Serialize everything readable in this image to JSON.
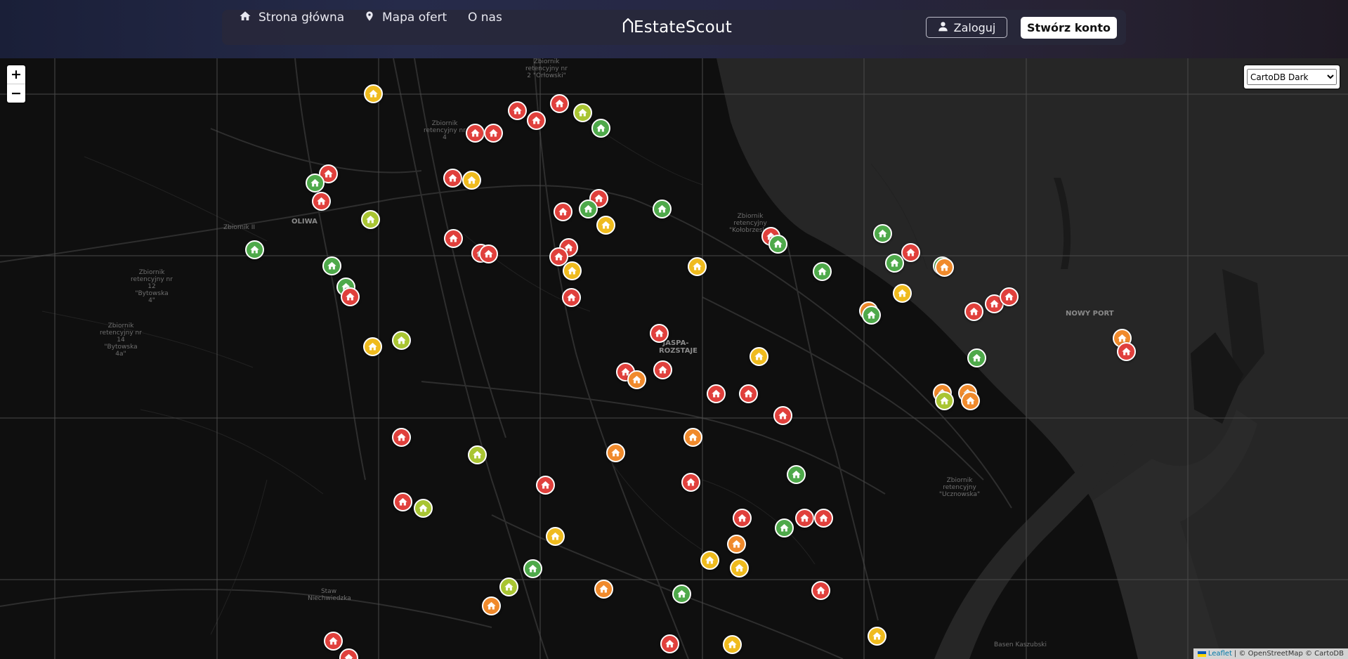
{
  "header": {
    "nav": [
      {
        "label": "Strona główna",
        "icon": "home-icon"
      },
      {
        "label": "Mapa ofert",
        "icon": "map-pin-icon"
      },
      {
        "label": "O nas",
        "icon": ""
      }
    ],
    "brand": "EstateScout",
    "login_label": "Zaloguj",
    "register_label": "Stwórz konto"
  },
  "map": {
    "zoom_in": "+",
    "zoom_out": "−",
    "layer_selected": "CartoDB Dark",
    "attribution_leaflet": "Leaflet",
    "attribution_rest": "| © OpenStreetMap © CartoDB",
    "labels": [
      "OLIWA",
      "NOWY PORT",
      "JASPA-ROZSTAJE",
      "Zbiornik retencyjny nr 2 \"Orłowski\"",
      "Zbiornik retencyjny nr 4",
      "Zbiornik retencyjny nr 12 \"Bytowska 4\"",
      "Zbiornik retencyjny nr 14 \"Bytowska 4a\"",
      "Zbiornik retencyjny \"Kołobrzeska\"",
      "Zbiornik retencyjny \"Ucznowska\"",
      "Staw Niechwiedzka",
      "Zbiornik II",
      "Basen Kaszubski"
    ],
    "marker_colors": {
      "red": "#e0403c",
      "orange": "#f08a2c",
      "yellow": "#efbb1e",
      "lime": "#a9c533",
      "green": "#4ea94a"
    }
  }
}
